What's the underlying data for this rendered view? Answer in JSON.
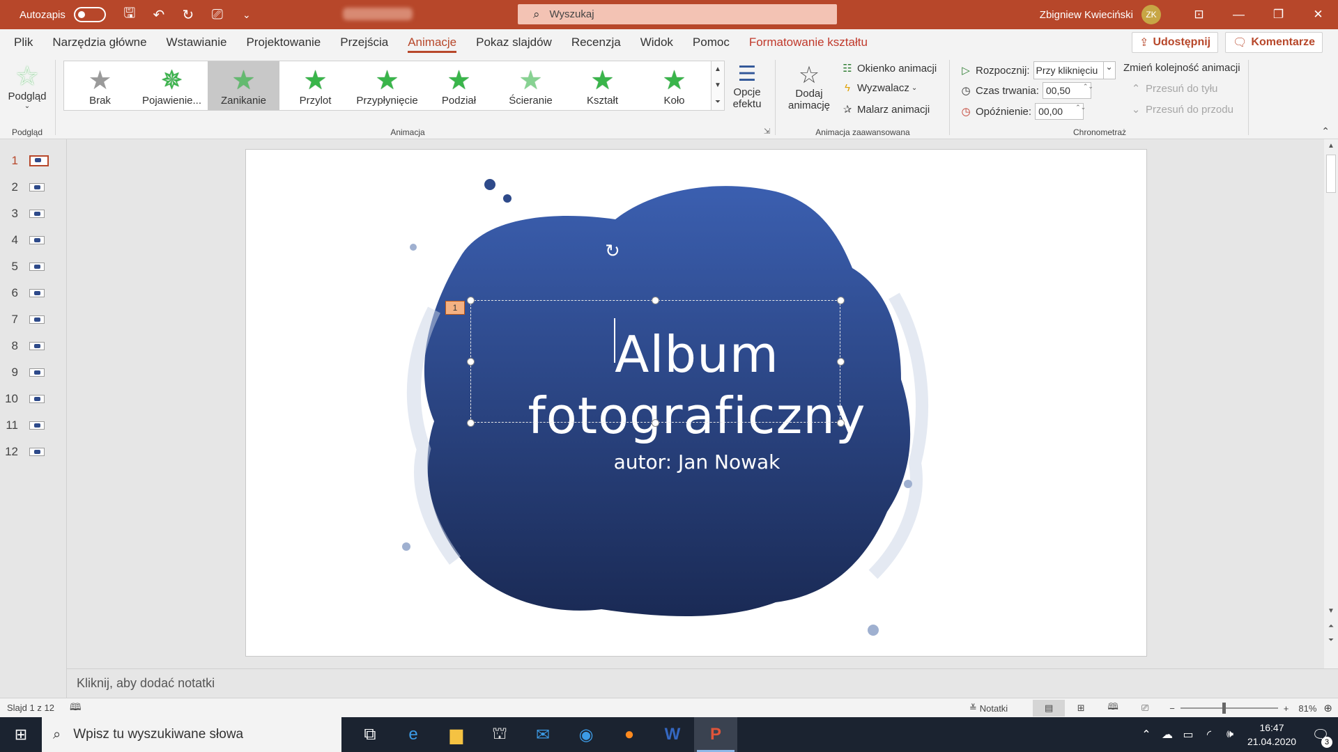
{
  "titlebar": {
    "autosave_label": "Autozapis",
    "search_placeholder": "Wyszukaj",
    "user_name": "Zbigniew Kwieciński",
    "user_initials": "ZK"
  },
  "tabs": [
    {
      "label": "Plik"
    },
    {
      "label": "Narzędzia główne"
    },
    {
      "label": "Wstawianie"
    },
    {
      "label": "Projektowanie"
    },
    {
      "label": "Przejścia"
    },
    {
      "label": "Animacje",
      "active": true
    },
    {
      "label": "Pokaz slajdów"
    },
    {
      "label": "Recenzja"
    },
    {
      "label": "Widok"
    },
    {
      "label": "Pomoc"
    },
    {
      "label": "Formatowanie kształtu",
      "contextual": true
    }
  ],
  "share": {
    "share_label": "Udostępnij",
    "comments_label": "Komentarze"
  },
  "ribbon": {
    "preview": {
      "button_label": "Podgląd",
      "group_label": "Podgląd"
    },
    "animations": {
      "group_label": "Animacja",
      "items": [
        {
          "label": "Brak",
          "icon": "star-gray-icon"
        },
        {
          "label": "Pojawienie...",
          "icon": "star-green-icon"
        },
        {
          "label": "Zanikanie",
          "icon": "star-green-icon",
          "selected": true
        },
        {
          "label": "Przylot",
          "icon": "star-green-icon"
        },
        {
          "label": "Przypłynięcie",
          "icon": "star-green-icon"
        },
        {
          "label": "Podział",
          "icon": "star-green-icon"
        },
        {
          "label": "Ścieranie",
          "icon": "star-green-icon"
        },
        {
          "label": "Kształt",
          "icon": "star-green-icon"
        },
        {
          "label": "Koło",
          "icon": "star-green-icon"
        }
      ],
      "effect_options_label_1": "Opcje",
      "effect_options_label_2": "efektu"
    },
    "advanced": {
      "group_label": "Animacja zaawansowana",
      "add_label_1": "Dodaj",
      "add_label_2": "animację",
      "pane_label": "Okienko animacji",
      "trigger_label": "Wyzwalacz",
      "painter_label": "Malarz animacji"
    },
    "timing": {
      "group_label": "Chronometraż",
      "start_label": "Rozpocznij:",
      "start_value": "Przy kliknięciu",
      "duration_label": "Czas trwania:",
      "duration_value": "00,50",
      "delay_label": "Opóźnienie:",
      "delay_value": "00,00",
      "reorder_label": "Zmień kolejność animacji",
      "move_earlier_label": "Przesuń do tyłu",
      "move_later_label": "Przesuń do przodu"
    }
  },
  "slides": [
    "1",
    "2",
    "3",
    "4",
    "5",
    "6",
    "7",
    "8",
    "9",
    "10",
    "11",
    "12"
  ],
  "slide": {
    "title_line1": "Album",
    "title_line2": "fotograficzny",
    "subtitle": "autor: Jan Nowak",
    "anim_tag": "1"
  },
  "notes_placeholder": "Kliknij, aby dodać notatki",
  "status": {
    "slide_info": "Slajd 1 z 12",
    "notes_label": "Notatki",
    "zoom": "81%"
  },
  "taskbar": {
    "search_placeholder": "Wpisz tu wyszukiwane słowa",
    "time": "16:47",
    "date": "21.04.2020",
    "notifications": "3"
  },
  "colors": {
    "accent": "#b7472a",
    "slide_blob": "#2e4a8a"
  }
}
